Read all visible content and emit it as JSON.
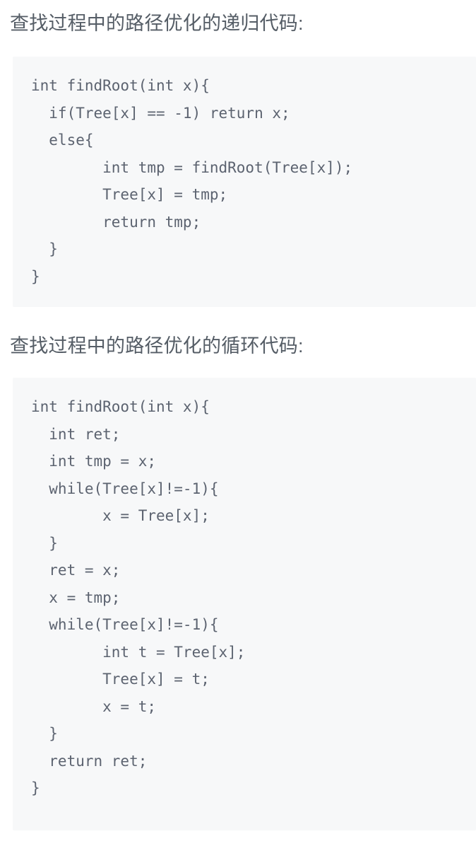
{
  "document": {
    "language": "zh-CN",
    "background_color": "#ffffff",
    "heading_color": "#555d66",
    "code_background_color": "#f7f8f9",
    "code_text_color": "#5c6370"
  },
  "sections": [
    {
      "heading": "查找过程中的路径优化的递归代码:",
      "code_language": "c",
      "code": "int findRoot(int x){\n  if(Tree[x] == -1) return x;\n  else{\n        int tmp = findRoot(Tree[x]);\n        Tree[x] = tmp;\n        return tmp;\n  }\n}",
      "code_lines": [
        "int findRoot(int x){",
        "  if(Tree[x] == -1) return x;",
        "  else{",
        "        int tmp = findRoot(Tree[x]);",
        "        Tree[x] = tmp;",
        "        return tmp;",
        "  }",
        "}"
      ]
    },
    {
      "heading": "查找过程中的路径优化的循环代码:",
      "code_language": "c",
      "code": "int findRoot(int x){\n  int ret;\n  int tmp = x;\n  while(Tree[x]!=-1){\n        x = Tree[x];\n  }\n  ret = x;\n  x = tmp;\n  while(Tree[x]!=-1){\n        int t = Tree[x];\n        Tree[x] = t;\n        x = t;\n  }\n  return ret;\n}",
      "code_lines": [
        "int findRoot(int x){",
        "  int ret;",
        "  int tmp = x;",
        "  while(Tree[x]!=-1){",
        "        x = Tree[x];",
        "  }",
        "  ret = x;",
        "  x = tmp;",
        "  while(Tree[x]!=-1){",
        "        int t = Tree[x];",
        "        Tree[x] = t;",
        "        x = t;",
        "  }",
        "  return ret;",
        "}"
      ]
    }
  ]
}
